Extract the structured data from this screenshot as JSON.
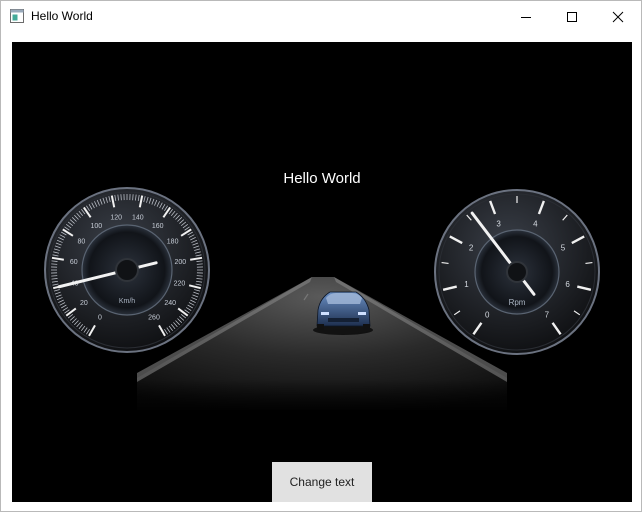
{
  "window": {
    "title": "Hello World"
  },
  "scene": {
    "label": "Hello World",
    "button_label": "Change text",
    "speedometer": {
      "unit": "Km/h",
      "ticks": [
        "0",
        "20",
        "40",
        "60",
        "80",
        "100",
        "120",
        "140",
        "160",
        "180",
        "200",
        "220",
        "240",
        "260"
      ],
      "value_kmh": 40
    },
    "tachometer": {
      "unit": "Rpm",
      "ticks": [
        "0",
        "1",
        "2",
        "3",
        "4",
        "5",
        "6",
        "7"
      ],
      "value_rpm": 2.6
    }
  }
}
